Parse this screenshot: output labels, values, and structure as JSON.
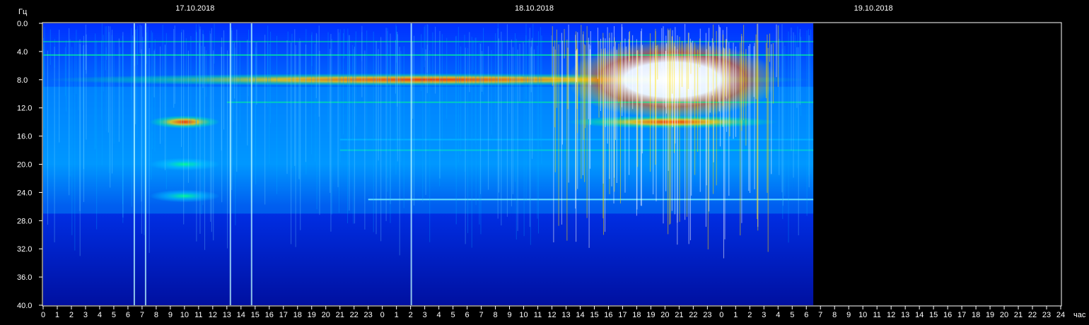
{
  "chart_data": {
    "type": "heatmap",
    "title": "",
    "ylabel": "Гц",
    "xlabel": "час",
    "ylim": [
      0,
      40
    ],
    "y_ticks": [
      "0.0",
      "4.0",
      "8.0",
      "12.0",
      "16.0",
      "20.0",
      "24.0",
      "28.0",
      "32.0",
      "36.0",
      "40.0"
    ],
    "dates": [
      "17.10.2018",
      "18.10.2018",
      "19.10.2018"
    ],
    "x_ticks": [
      "0",
      "1",
      "2",
      "3",
      "4",
      "5",
      "6",
      "7",
      "8",
      "9",
      "10",
      "11",
      "12",
      "13",
      "14",
      "15",
      "16",
      "17",
      "18",
      "19",
      "20",
      "21",
      "22",
      "23",
      "0",
      "1",
      "2",
      "3",
      "4",
      "5",
      "6",
      "7",
      "8",
      "9",
      "10",
      "11",
      "12",
      "13",
      "14",
      "15",
      "16",
      "17",
      "18",
      "19",
      "20",
      "21",
      "22",
      "23",
      "0",
      "1",
      "2",
      "3",
      "4",
      "5",
      "6",
      "7",
      "8",
      "9",
      "10",
      "11",
      "12",
      "13",
      "14",
      "15",
      "16",
      "17",
      "18",
      "19",
      "20",
      "21",
      "22",
      "23",
      "24"
    ],
    "x_range_hours": [
      0,
      72
    ],
    "data_end_hour": 54.5,
    "grid": false,
    "colormap": [
      "#00006e",
      "#0022ff",
      "#00b4ff",
      "#00ff90",
      "#ffff00",
      "#ff2000",
      "#ffffff"
    ],
    "bands": [
      {
        "freq_hz": 8,
        "start_h": 0,
        "end_h": 54.5,
        "intensity": 0.62
      },
      {
        "freq_hz": 14,
        "start_h": 7.5,
        "end_h": 12.5,
        "intensity": 0.7
      },
      {
        "freq_hz": 20,
        "start_h": 7.5,
        "end_h": 12.5,
        "intensity": 0.45
      },
      {
        "freq_hz": 24.5,
        "start_h": 7.5,
        "end_h": 12.5,
        "intensity": 0.45
      },
      {
        "freq_hz": 8,
        "start_h": 37,
        "end_h": 52,
        "intensity": 1.0
      },
      {
        "freq_hz": 14,
        "start_h": 37,
        "end_h": 52,
        "intensity": 0.6
      }
    ]
  }
}
